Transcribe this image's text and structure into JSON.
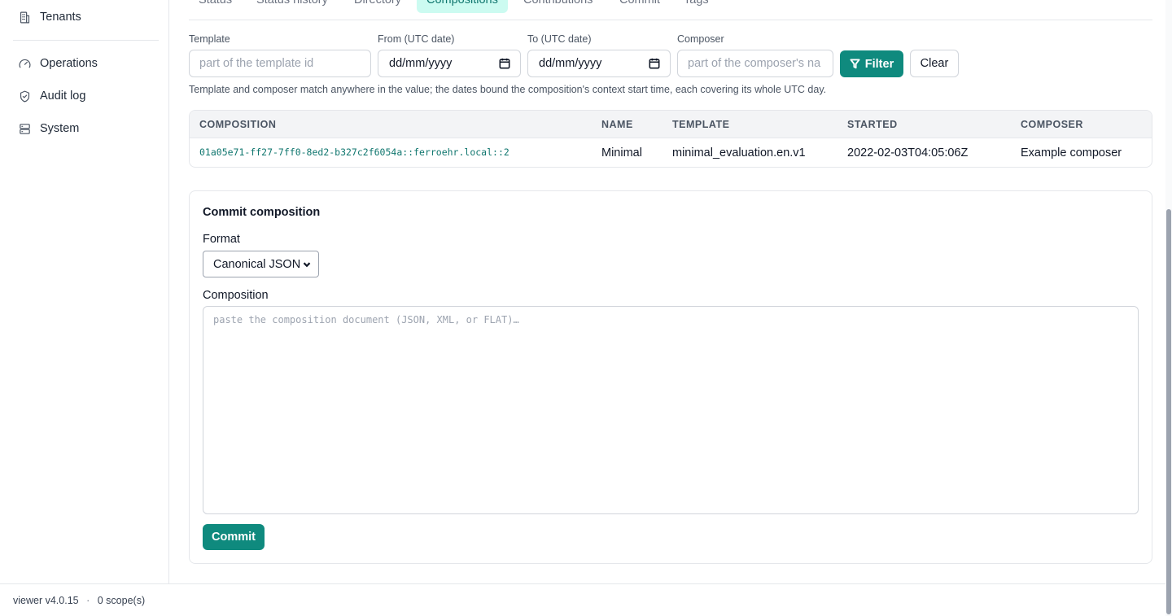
{
  "sidebar": {
    "items": [
      {
        "label": "Tenants",
        "icon": "building-icon"
      },
      {
        "label": "Operations",
        "icon": "gauge-icon"
      },
      {
        "label": "Audit log",
        "icon": "shield-icon"
      },
      {
        "label": "System",
        "icon": "server-icon"
      }
    ]
  },
  "tabs": [
    {
      "label": "Status"
    },
    {
      "label": "Status history"
    },
    {
      "label": "Directory"
    },
    {
      "label": "Compositions",
      "active": true
    },
    {
      "label": "Contributions"
    },
    {
      "label": "Commit"
    },
    {
      "label": "Tags"
    }
  ],
  "filters": {
    "template": {
      "label": "Template",
      "placeholder": "part of the template id",
      "value": ""
    },
    "from": {
      "label": "From (UTC date)",
      "value": "dd/mm/yyyy"
    },
    "to": {
      "label": "To (UTC date)",
      "value": "dd/mm/yyyy"
    },
    "composer": {
      "label": "Composer",
      "placeholder": "part of the composer's na",
      "value": ""
    },
    "filter_label": "Filter",
    "clear_label": "Clear",
    "hint": "Template and composer match anywhere in the value; the dates bound the composition's context start time, each covering its whole UTC day."
  },
  "table": {
    "columns": [
      "COMPOSITION",
      "NAME",
      "TEMPLATE",
      "STARTED",
      "COMPOSER"
    ],
    "rows": [
      [
        "01a05e71-ff27-7ff0-8ed2-b327c2f6054a::ferroehr.local::2",
        "Minimal",
        "minimal_evaluation.en.v1",
        "2022-02-03T04:05:06Z",
        "Example composer"
      ]
    ]
  },
  "commit": {
    "title": "Commit composition",
    "format_label": "Format",
    "format_value": "Canonical JSON",
    "composition_label": "Composition",
    "composition_placeholder": "paste the composition document (JSON, XML, or FLAT)…",
    "commit_label": "Commit"
  },
  "footer": {
    "version": "viewer v4.0.15",
    "separator": "·",
    "scopes": "0 scope(s)"
  },
  "colors": {
    "accent": "#0f8a7e",
    "accent_light": "#ccfbf1",
    "link": "#0f766e"
  }
}
